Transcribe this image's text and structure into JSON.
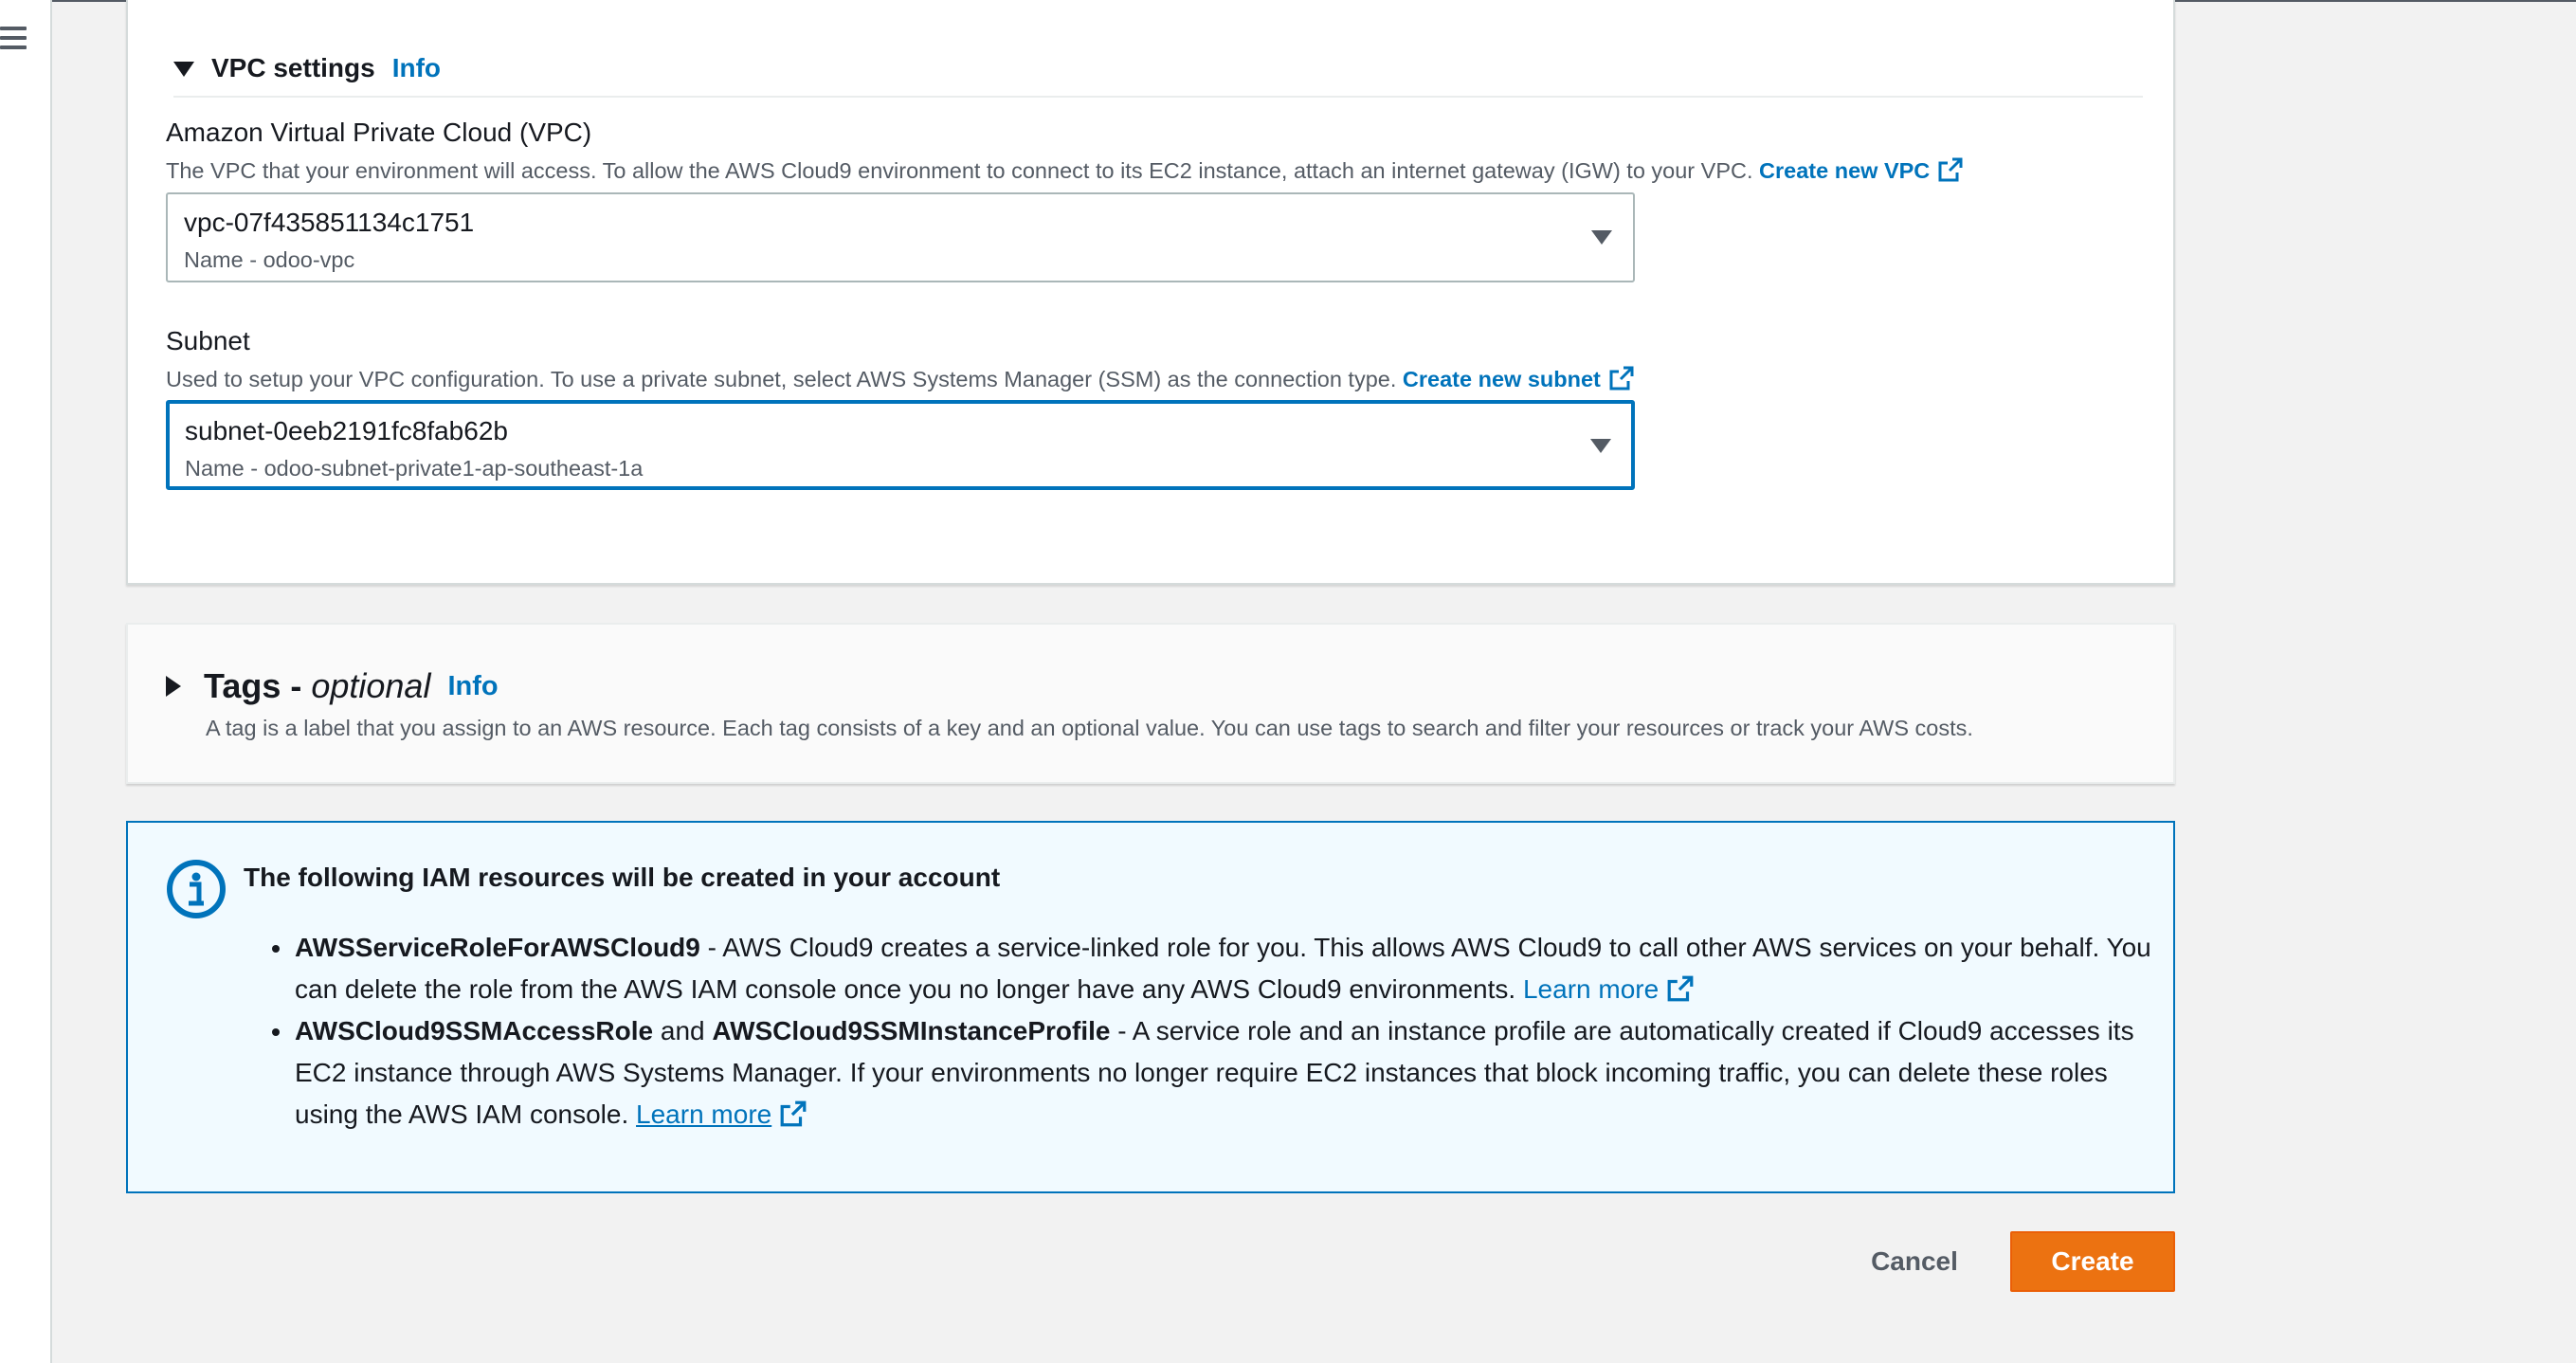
{
  "vpc_settings": {
    "title": "VPC settings",
    "info": "Info",
    "vpc_field": {
      "label": "Amazon Virtual Private Cloud (VPC)",
      "description": "The VPC that your environment will access. To allow the AWS Cloud9 environment to connect to its EC2 instance, attach an internet gateway (IGW) to your VPC.",
      "create_link": "Create new VPC",
      "value": "vpc-07f435851134c1751",
      "sub_value": "Name - odoo-vpc"
    },
    "subnet_field": {
      "label": "Subnet",
      "description": "Used to setup your VPC configuration. To use a private subnet, select AWS Systems Manager (SSM) as the connection type.",
      "create_link": "Create new subnet",
      "value": "subnet-0eeb2191fc8fab62b",
      "sub_value": "Name - odoo-subnet-private1-ap-southeast-1a"
    }
  },
  "tags": {
    "title": "Tags -",
    "title_optional": "optional",
    "info": "Info",
    "description": "A tag is a label that you assign to an AWS resource. Each tag consists of a key and an optional value. You can use tags to search and filter your resources or track your AWS costs."
  },
  "iam_alert": {
    "title": "The following IAM resources will be created in your account",
    "item1": {
      "bold": "AWSServiceRoleForAWSCloud9",
      "text": " - AWS Cloud9 creates a service-linked role for you. This allows AWS Cloud9 to call other AWS services on your behalf. You can delete the role from the AWS IAM console once you no longer have any AWS Cloud9 environments. ",
      "link": "Learn more"
    },
    "item2": {
      "bold1": "AWSCloud9SSMAccessRole",
      "and": " and ",
      "bold2": "AWSCloud9SSMInstanceProfile",
      "text": " - A service role and an instance profile are automatically created if Cloud9 accesses its EC2 instance through AWS Systems Manager. If your environments no longer require EC2 instances that block incoming traffic, you can delete these roles using the AWS IAM console. ",
      "link": "Learn more"
    }
  },
  "actions": {
    "cancel": "Cancel",
    "create": "Create"
  },
  "colors": {
    "link": "#0073bb",
    "primary_button": "#ec7211",
    "info_bg": "#f1faff",
    "info_border": "#0073bb"
  },
  "icons": {
    "menu": "hamburger-menu-icon",
    "external": "external-link-icon",
    "info": "info-circle-icon",
    "dropdown": "caret-down-icon",
    "expand": "caret-right-icon"
  }
}
